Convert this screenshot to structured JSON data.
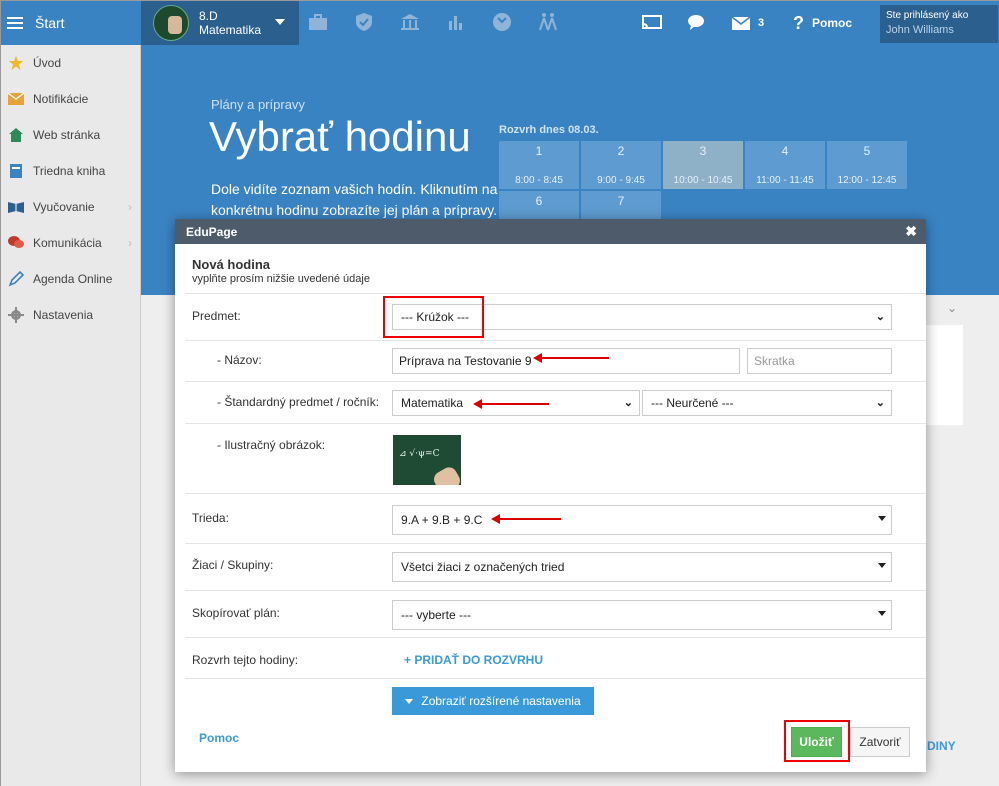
{
  "topbar": {
    "start_label": "Štart",
    "class_code": "8.D",
    "class_subject": "Matematika",
    "messages_count": "3",
    "help_label": "Pomoc",
    "user_logged_as": "Ste prihlásený ako",
    "user_name": "John Williams",
    "nav_icons": [
      "briefcase-icon",
      "shield-icon",
      "bank-icon",
      "bar-chart-icon",
      "clock-icon",
      "people-walking-icon"
    ]
  },
  "sidebar": {
    "items": [
      {
        "label": "Úvod",
        "icon": "star-icon"
      },
      {
        "label": "Notifikácie",
        "icon": "envelope-icon"
      },
      {
        "label": "Web stránka",
        "icon": "home-icon"
      },
      {
        "label": "Triedna kniha",
        "icon": "book-icon"
      },
      {
        "label": "Vyučovanie",
        "icon": "open-book-icon"
      },
      {
        "label": "Komunikácia",
        "icon": "chat-icon"
      },
      {
        "label": "Agenda Online",
        "icon": "pen-icon"
      },
      {
        "label": "Nastavenia",
        "icon": "gear-icon"
      }
    ]
  },
  "hero": {
    "breadcrumb": "Plány a prípravy",
    "title": "Vybrať hodinu",
    "description": "Dole vidíte zoznam vašich hodín. Kliknutím na konkrétnu hodinu zobrazíte jej plán a prípravy.",
    "today_label": "Rozvrh dnes 08.03.",
    "slots": [
      {
        "n": "1",
        "time": "8:00 - 8:45"
      },
      {
        "n": "2",
        "time": "9:00 - 9:45"
      },
      {
        "n": "3",
        "time": "10:00 - 10:45"
      },
      {
        "n": "4",
        "time": "11:00 - 11:45"
      },
      {
        "n": "5",
        "time": "12:00 - 12:45"
      },
      {
        "n": "6",
        "time": ""
      },
      {
        "n": "7",
        "time": ""
      }
    ]
  },
  "background": {
    "diny_fragment": "DINY"
  },
  "dialog": {
    "header": "EduPage",
    "title": "Nová hodina",
    "subtitle": "vyplňte prosím nižšie uvedené údaje",
    "fields": {
      "predmet_label": "Predmet:",
      "predmet_value": "--- Krúžok ---",
      "nazov_label": "- Názov:",
      "nazov_value": "Príprava na Testovanie 9",
      "skratka_placeholder": "Skratka",
      "standard_label": "- Štandardný predmet / ročník:",
      "standard_value": "Matematika",
      "rocnik_value": "--- Neurčené ---",
      "obrazok_label": "- Ilustračný obrázok:",
      "trieda_label": "Trieda:",
      "trieda_value": "9.A + 9.B + 9.C",
      "ziaci_label": "Žiaci / Skupiny:",
      "ziaci_value": "Všetci žiaci z označených tried",
      "plan_label": "Skopírovať plán:",
      "plan_value": "--- vyberte ---",
      "rozvrh_label": "Rozvrh tejto hodiny:",
      "rozvrh_link": "+ PRIDAŤ DO ROZVRHU"
    },
    "advanced_button": "Zobraziť rozšírené nastavenia",
    "help_link": "Pomoc",
    "save_button": "Uložiť",
    "close_button": "Zatvoriť"
  },
  "colors": {
    "primary": "#3a83c3",
    "dark_header": "#4d5b6a",
    "accent_blue": "#3a9ad9",
    "save_green": "#5cb85c",
    "annotation_red": "#e00000"
  }
}
